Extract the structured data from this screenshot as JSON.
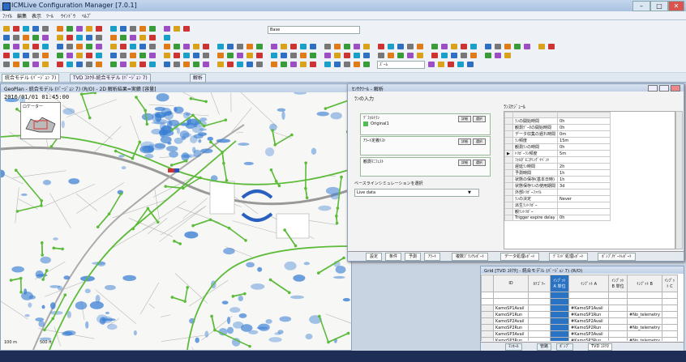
{
  "app": {
    "title": "ICMLive Configuration Manager [7.0.1]"
  },
  "menu": [
    "ﾌｧｲﾙ",
    "編集",
    "表示",
    "ﾂｰﾙ",
    "ｳｲﾝﾄﾞｳ",
    "ﾍﾙﾌﾟ"
  ],
  "toolbar": {
    "theme_select": "Base",
    "zoom_select": "ｽﾞｰﾑ"
  },
  "object_tabs": [
    {
      "label": "統合モデル (ﾊﾞｰｼﾞｮﾝ 7)"
    },
    {
      "label": "TVD ｺﾈｸﾀ-統合モデル (ﾊﾞｰｼﾞｮﾝ 7)"
    },
    {
      "label": "解析"
    }
  ],
  "map": {
    "title": "GeoPlan - 統合モデル (ﾊﾞｰｼﾞｮﾝ 7) (R/O) - 2D 解析結果=実績 [容量]",
    "datetime": "2016/01/01 01:45:00",
    "locator_label": "ロケーター",
    "scale_a": "100 m",
    "scale_b": "500 ft"
  },
  "inspector": {
    "title": "ｾﾝｻｸﾂｰﾙ - 解析",
    "run_input_label": "ﾗﾝの入力",
    "default_run_label": "ﾃﾞﾌｫﾙﾄﾗﾝ",
    "default_run_value": "Original1",
    "alert_list_label": "ｱﾗｰﾄ定義ﾘｽﾄ",
    "observed_manifest_label": "観測ﾏﾆﾌｪｽﾄ",
    "baseline_label": "ベースラインシミュレーションを選択",
    "baseline_value": "Live data",
    "btn_a": "詳細",
    "btn_b": "選択",
    "schedule_title": "ﾗﾝｽｹｼﾞｭｰﾙ",
    "schedule_rows": [
      {
        "name": "ﾗﾝの開始時間",
        "value": "0h"
      },
      {
        "name": "観測ﾃﾞｰﾀの開始時間",
        "value": "0h"
      },
      {
        "name": "データ収集の遅れ時間",
        "value": "0m"
      },
      {
        "name": "ﾗﾝ頻度",
        "value": "15m"
      },
      {
        "name": "観測ﾗﾝの時間",
        "value": "0h"
      },
      {
        "name": "ﾄﾘｶﾞｰﾗﾝ頻度",
        "value": "5m"
      },
      {
        "name": "ﾌｫﾙﾀﾞﾓﾆﾀﾘﾝｸﾞｲﾍﾞﾝﾄ",
        "value": ""
      },
      {
        "name": "遅延ﾗﾝ時間",
        "value": "2h"
      },
      {
        "name": "予測時間",
        "value": "1h"
      },
      {
        "name": "状態の保存(基本日時)",
        "value": "1h"
      },
      {
        "name": "状態保存ﾗﾝの使用期間",
        "value": "3d"
      },
      {
        "name": "外部ﾄﾘｶﾞｰﾌｧｲﾙ",
        "value": ""
      },
      {
        "name": "ﾗﾝの決定",
        "value": "Never"
      },
      {
        "name": "派生ﾗﾝﾄﾘｶﾞｰ",
        "value": ""
      },
      {
        "name": "観ﾗﾝﾄﾘｶﾞｰ",
        "value": ""
      },
      {
        "name": "Trigger expire delay",
        "value": "0h"
      }
    ],
    "tabs": [
      "設定",
      "条件",
      "予測",
      "ｱﾗｰﾄ",
      "複数ﾌﾞﾗﾝﾁﾚﾎﾟｰﾄ",
      "データ処理ﾚﾎﾟｰﾄ",
      "ﾃﾞﾏﾝﾄﾞ処理ﾚﾎﾟｰﾄ",
      "ﾎﾟﾝﾌﾟ/ｹﾞｰﾄﾚﾎﾟｰﾄ"
    ]
  },
  "grid": {
    "title": "Grid [TVD ｺﾈｸﾀ] - 統合モデル (ﾊﾞｰｼﾞｮﾝ 7) (R/O)",
    "columns": [
      "ID",
      "ｶﾃｺﾞﾘｰ",
      "ｲﾝﾌﾟｯﾄ A 単位",
      "ｲﾝﾌﾟｯﾄ A",
      "ｲﾝﾌﾟｯﾄ B 単位",
      "ｲﾝﾌﾟｯﾄ B",
      "ｲﾝﾌﾟｯﾄ C"
    ],
    "rows": [
      [
        "KamoSP1Avail",
        "",
        "",
        "#KamoSP1Avail",
        "",
        "",
        ""
      ],
      [
        "KamoSP1Run",
        "",
        "",
        "#KamoSP1Run",
        "",
        "#No_telemetry",
        ""
      ],
      [
        "KamoSP2Avail",
        "",
        "",
        "#KamoSP2Avail",
        "",
        "",
        ""
      ],
      [
        "KamoSP2Run",
        "",
        "",
        "#KamoSP2Run",
        "",
        "#No_telemetry",
        ""
      ],
      [
        "KamoSP3Avail",
        "",
        "",
        "#KamoSP3Avail",
        "",
        "",
        ""
      ],
      [
        "KamoSP3Run",
        "",
        "",
        "#KamoSP3Run",
        "",
        "#No_telemetry",
        ""
      ]
    ],
    "tabs": [
      "ﾏﾝﾎｰﾙ",
      "管路",
      "ﾎﾟﾝﾌﾟ",
      "TVD ｺﾈｸﾀ"
    ]
  },
  "colors": {
    "accent": "#2a72c2",
    "water_blue": "#3a7fd4",
    "network_green": "#5dbb3a"
  }
}
